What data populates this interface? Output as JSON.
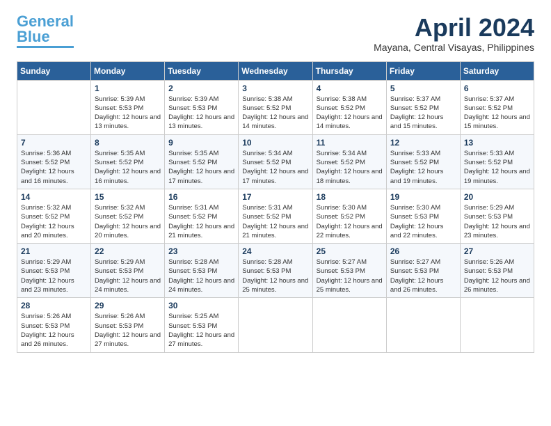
{
  "header": {
    "logo_general": "General",
    "logo_blue": "Blue",
    "month_title": "April 2024",
    "location": "Mayana, Central Visayas, Philippines"
  },
  "days_of_week": [
    "Sunday",
    "Monday",
    "Tuesday",
    "Wednesday",
    "Thursday",
    "Friday",
    "Saturday"
  ],
  "weeks": [
    [
      {
        "day": null
      },
      {
        "day": "1",
        "sunrise": "5:39 AM",
        "sunset": "5:53 PM",
        "daylight": "12 hours and 13 minutes."
      },
      {
        "day": "2",
        "sunrise": "5:39 AM",
        "sunset": "5:53 PM",
        "daylight": "12 hours and 13 minutes."
      },
      {
        "day": "3",
        "sunrise": "5:38 AM",
        "sunset": "5:52 PM",
        "daylight": "12 hours and 14 minutes."
      },
      {
        "day": "4",
        "sunrise": "5:38 AM",
        "sunset": "5:52 PM",
        "daylight": "12 hours and 14 minutes."
      },
      {
        "day": "5",
        "sunrise": "5:37 AM",
        "sunset": "5:52 PM",
        "daylight": "12 hours and 15 minutes."
      },
      {
        "day": "6",
        "sunrise": "5:37 AM",
        "sunset": "5:52 PM",
        "daylight": "12 hours and 15 minutes."
      }
    ],
    [
      {
        "day": "7",
        "sunrise": "5:36 AM",
        "sunset": "5:52 PM",
        "daylight": "12 hours and 16 minutes."
      },
      {
        "day": "8",
        "sunrise": "5:35 AM",
        "sunset": "5:52 PM",
        "daylight": "12 hours and 16 minutes."
      },
      {
        "day": "9",
        "sunrise": "5:35 AM",
        "sunset": "5:52 PM",
        "daylight": "12 hours and 17 minutes."
      },
      {
        "day": "10",
        "sunrise": "5:34 AM",
        "sunset": "5:52 PM",
        "daylight": "12 hours and 17 minutes."
      },
      {
        "day": "11",
        "sunrise": "5:34 AM",
        "sunset": "5:52 PM",
        "daylight": "12 hours and 18 minutes."
      },
      {
        "day": "12",
        "sunrise": "5:33 AM",
        "sunset": "5:52 PM",
        "daylight": "12 hours and 19 minutes."
      },
      {
        "day": "13",
        "sunrise": "5:33 AM",
        "sunset": "5:52 PM",
        "daylight": "12 hours and 19 minutes."
      }
    ],
    [
      {
        "day": "14",
        "sunrise": "5:32 AM",
        "sunset": "5:52 PM",
        "daylight": "12 hours and 20 minutes."
      },
      {
        "day": "15",
        "sunrise": "5:32 AM",
        "sunset": "5:52 PM",
        "daylight": "12 hours and 20 minutes."
      },
      {
        "day": "16",
        "sunrise": "5:31 AM",
        "sunset": "5:52 PM",
        "daylight": "12 hours and 21 minutes."
      },
      {
        "day": "17",
        "sunrise": "5:31 AM",
        "sunset": "5:52 PM",
        "daylight": "12 hours and 21 minutes."
      },
      {
        "day": "18",
        "sunrise": "5:30 AM",
        "sunset": "5:52 PM",
        "daylight": "12 hours and 22 minutes."
      },
      {
        "day": "19",
        "sunrise": "5:30 AM",
        "sunset": "5:53 PM",
        "daylight": "12 hours and 22 minutes."
      },
      {
        "day": "20",
        "sunrise": "5:29 AM",
        "sunset": "5:53 PM",
        "daylight": "12 hours and 23 minutes."
      }
    ],
    [
      {
        "day": "21",
        "sunrise": "5:29 AM",
        "sunset": "5:53 PM",
        "daylight": "12 hours and 23 minutes."
      },
      {
        "day": "22",
        "sunrise": "5:29 AM",
        "sunset": "5:53 PM",
        "daylight": "12 hours and 24 minutes."
      },
      {
        "day": "23",
        "sunrise": "5:28 AM",
        "sunset": "5:53 PM",
        "daylight": "12 hours and 24 minutes."
      },
      {
        "day": "24",
        "sunrise": "5:28 AM",
        "sunset": "5:53 PM",
        "daylight": "12 hours and 25 minutes."
      },
      {
        "day": "25",
        "sunrise": "5:27 AM",
        "sunset": "5:53 PM",
        "daylight": "12 hours and 25 minutes."
      },
      {
        "day": "26",
        "sunrise": "5:27 AM",
        "sunset": "5:53 PM",
        "daylight": "12 hours and 26 minutes."
      },
      {
        "day": "27",
        "sunrise": "5:26 AM",
        "sunset": "5:53 PM",
        "daylight": "12 hours and 26 minutes."
      }
    ],
    [
      {
        "day": "28",
        "sunrise": "5:26 AM",
        "sunset": "5:53 PM",
        "daylight": "12 hours and 26 minutes."
      },
      {
        "day": "29",
        "sunrise": "5:26 AM",
        "sunset": "5:53 PM",
        "daylight": "12 hours and 27 minutes."
      },
      {
        "day": "30",
        "sunrise": "5:25 AM",
        "sunset": "5:53 PM",
        "daylight": "12 hours and 27 minutes."
      },
      {
        "day": null
      },
      {
        "day": null
      },
      {
        "day": null
      },
      {
        "day": null
      }
    ]
  ]
}
